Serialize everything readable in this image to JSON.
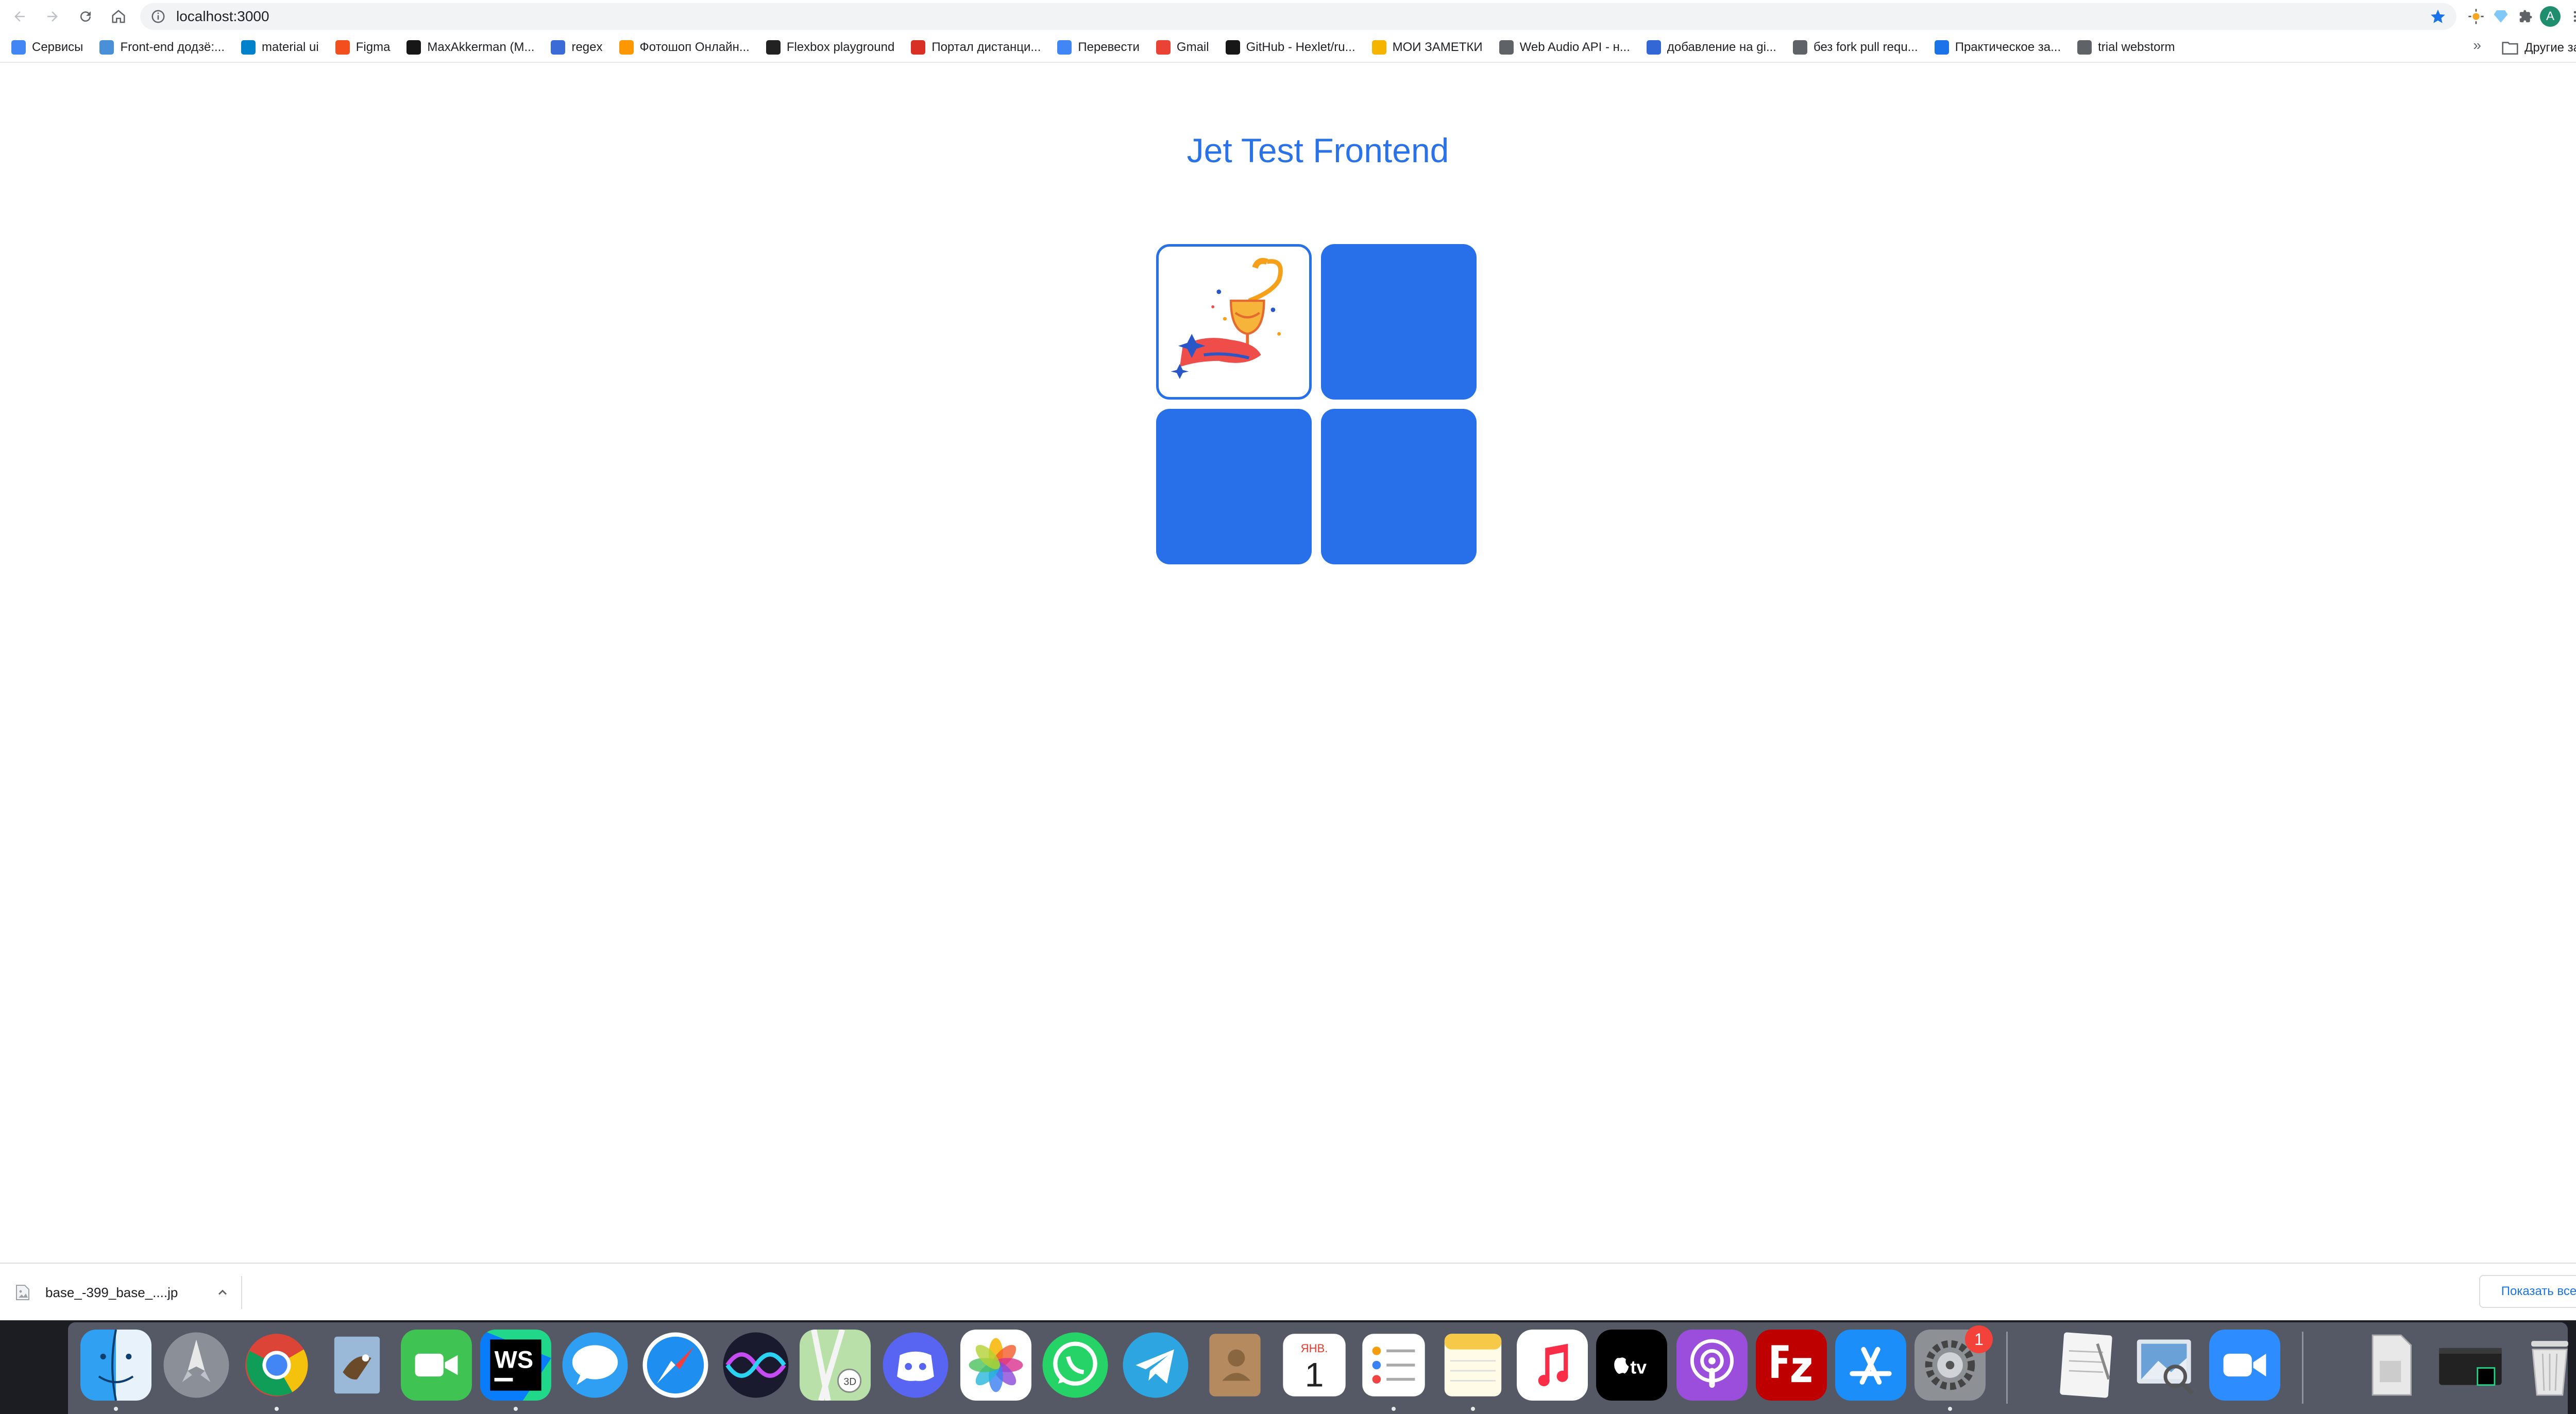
{
  "browser": {
    "url": "localhost:3000",
    "profile_initial": "A",
    "bookmarks": [
      {
        "label": "Сервисы",
        "icon": "apps-grid-icon",
        "color": "#4285f4"
      },
      {
        "label": "Front-end додзё:...",
        "icon": "page-icon",
        "color": "#4a90d9"
      },
      {
        "label": "material ui",
        "icon": "material-ui-icon",
        "color": "#0081cb"
      },
      {
        "label": "Figma",
        "icon": "figma-icon",
        "color": "#f24e1e"
      },
      {
        "label": "MaxAkkerman (M...",
        "icon": "github-icon",
        "color": "#181717"
      },
      {
        "label": "regex",
        "icon": "regex-icon",
        "color": "#3b6bd6"
      },
      {
        "label": "Фотошоп Онлайн...",
        "icon": "photo-icon",
        "color": "#ff9800"
      },
      {
        "label": "Flexbox playground",
        "icon": "codepen-icon",
        "color": "#222222"
      },
      {
        "label": "Портал дистанци...",
        "icon": "portal-icon",
        "color": "#d93025"
      },
      {
        "label": "Перевести",
        "icon": "translate-icon",
        "color": "#4285f4"
      },
      {
        "label": "Gmail",
        "icon": "gmail-icon",
        "color": "#ea4335"
      },
      {
        "label": "GitHub - Hexlet/ru...",
        "icon": "github-icon",
        "color": "#181717"
      },
      {
        "label": "МОИ ЗАМЕТКИ",
        "icon": "notes-icon",
        "color": "#f4b400"
      },
      {
        "label": "Web Audio API - н...",
        "icon": "globe-icon",
        "color": "#5f6368"
      },
      {
        "label": "добавление на gi...",
        "icon": "doc-icon",
        "color": "#3367d6"
      },
      {
        "label": "без fork pull requ...",
        "icon": "globe-icon",
        "color": "#5f6368"
      },
      {
        "label": "Практическое за...",
        "icon": "mail-icon",
        "color": "#1a73e8"
      },
      {
        "label": "trial webstorm",
        "icon": "globe-icon",
        "color": "#5f6368"
      }
    ],
    "bookmarks_overflow": "»",
    "other_bookmarks": "Другие закладки"
  },
  "page": {
    "title": "Jet Test Frontend",
    "cards": [
      {
        "state": "open",
        "icon": "pouring-drink-illustration-icon"
      },
      {
        "state": "closed",
        "icon": ""
      },
      {
        "state": "closed",
        "icon": ""
      },
      {
        "state": "closed",
        "icon": ""
      }
    ],
    "accent_color": "#2870ea"
  },
  "downloads": {
    "file_name": "base_-399_base_....jp",
    "show_all": "Показать все"
  },
  "dock": {
    "calendar_month": "ЯНВ.",
    "calendar_day": "1",
    "settings_badge": "1",
    "tv_label": "tv",
    "ws_label": "WS",
    "apps": [
      "finder-icon",
      "launchpad-icon",
      "chrome-icon",
      "preview-bird-icon",
      "facetime-icon",
      "webstorm-icon",
      "messages-icon",
      "safari-icon",
      "siri-icon",
      "maps-icon",
      "discord-icon",
      "photos-icon",
      "whatsapp-icon",
      "telegram-icon",
      "contacts-icon",
      "calendar-icon",
      "reminders-icon",
      "notes-icon",
      "music-icon",
      "apple-tv-icon",
      "podcasts-icon",
      "filezilla-icon",
      "app-store-icon",
      "system-preferences-icon",
      "textedit-icon",
      "preview-icon",
      "zoom-icon",
      "downloads-stack-icon",
      "terminal-webstorm-icon",
      "trash-icon"
    ]
  }
}
